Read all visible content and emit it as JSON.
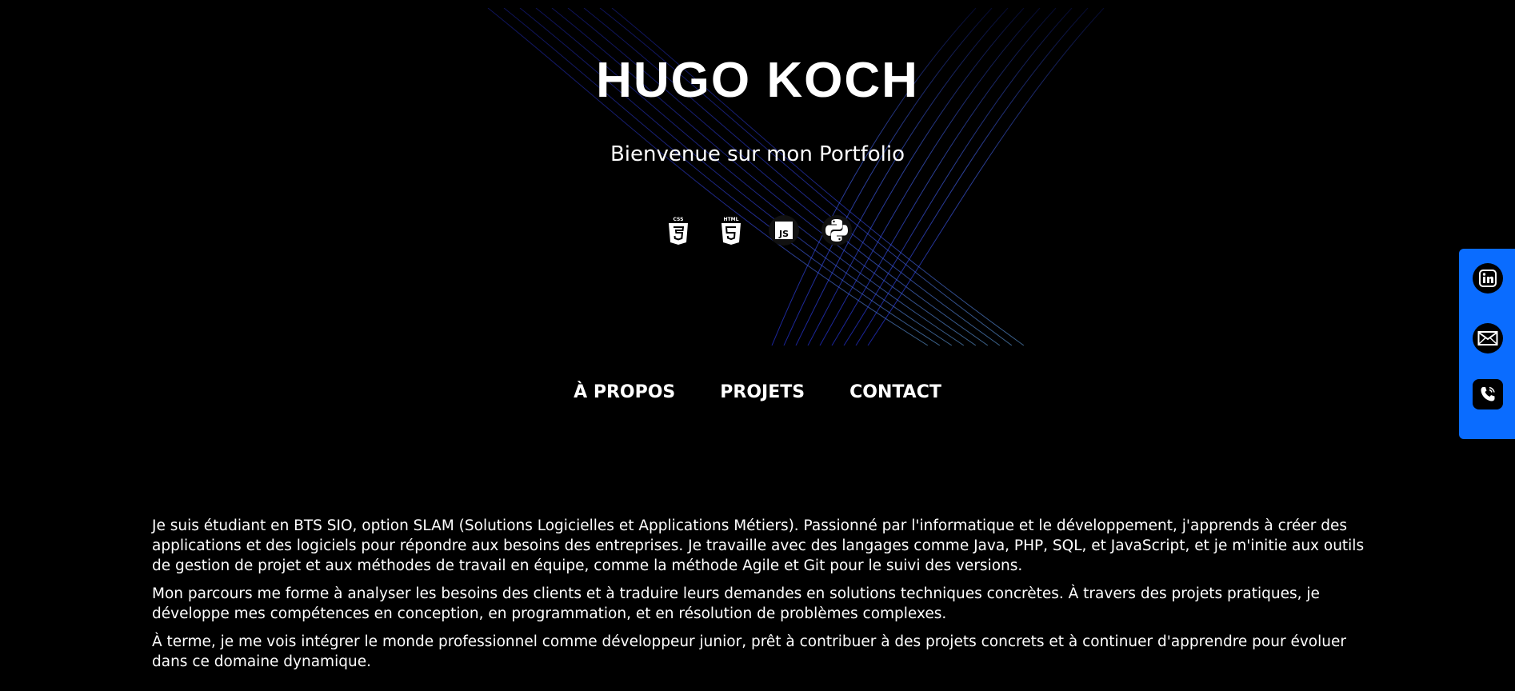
{
  "header": {
    "title": "HUGO KOCH",
    "subtitle": "Bienvenue sur mon Portfolio"
  },
  "tech_icons": [
    {
      "name": "css3-icon",
      "label": "CSS"
    },
    {
      "name": "html5-icon",
      "label": "HTML"
    },
    {
      "name": "javascript-icon",
      "label": "JS"
    },
    {
      "name": "python-icon",
      "label": ""
    }
  ],
  "nav": {
    "about_label": "À PROPOS",
    "projects_label": "PROJETS",
    "contact_label": "CONTACT"
  },
  "about": {
    "paragraph1": "Je suis étudiant en BTS SIO, option SLAM (Solutions Logicielles et Applications Métiers). Passionné par l'informatique et le développement, j'apprends à créer des applications et des logiciels pour répondre aux besoins des entreprises. Je travaille avec des langages comme Java, PHP, SQL, et JavaScript, et je m'initie aux outils de gestion de projet et aux méthodes de travail en équipe, comme la méthode Agile et Git pour le suivi des versions.",
    "paragraph2": "Mon parcours me forme à analyser les besoins des clients et à traduire leurs demandes en solutions techniques concrètes. À travers des projets pratiques, je développe mes compétences en conception, en programmation, et en résolution de problèmes complexes.",
    "paragraph3": "À terme, je me vois intégrer le monde professionnel comme développeur junior, prêt à contribuer à des projets concrets et à continuer d'apprendre pour évoluer dans ce domaine dynamique."
  },
  "social": {
    "items": [
      "linkedin-icon",
      "mail-icon",
      "phone-icon"
    ]
  },
  "colors": {
    "background": "#000000",
    "accent_blue": "#0a6cff",
    "wave_blue": "#3a4dff",
    "wave_light": "#6fb6ff"
  }
}
